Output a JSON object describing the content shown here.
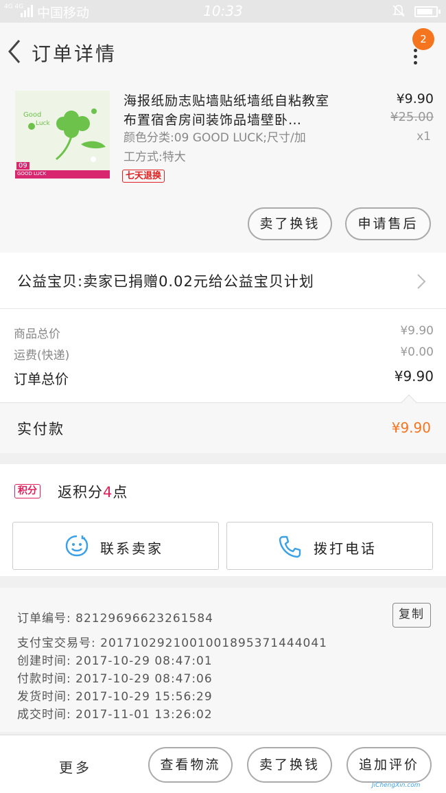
{
  "status_bar": {
    "signal_label": "4G 4G",
    "carrier": "中国移动",
    "time": "10:33",
    "icons": [
      "signal-icon",
      "bell-muted-icon",
      "battery-icon"
    ]
  },
  "nav": {
    "title": "订单详情",
    "badge_count": "2",
    "icons": [
      "back-arrow-icon",
      "more-dots-icon"
    ]
  },
  "item": {
    "title": "海报纸励志贴墙贴纸墙纸自粘教室布置宿舍房间装饰品墙壁卧…",
    "sku_line1": "颜色分类:09 GOOD LUCK;尺寸/加",
    "sku_line2": "工方式:特大",
    "tag": "七天退换",
    "price": "¥9.90",
    "original_price": "¥25.00",
    "quantity": "x1",
    "thumb_number": "09",
    "thumb_caption": "GOOD LUCK",
    "buttons": [
      "卖了换钱",
      "申请售后"
    ]
  },
  "charity": {
    "text": "公益宝贝:卖家已捐赠0.02元给公益宝贝计划"
  },
  "fees": {
    "rows": [
      {
        "label": "商品总价",
        "value": "¥9.90"
      },
      {
        "label": "运费(快递)",
        "value": "¥0.00"
      },
      {
        "label": "订单总价",
        "value": "¥9.90"
      }
    ]
  },
  "payment": {
    "label": "实付款",
    "value": "¥9.90"
  },
  "points": {
    "tag": "积分",
    "prefix": "返积分",
    "number": "4",
    "suffix": "点"
  },
  "contact": {
    "seller_label": "联系卖家",
    "phone_label": "拨打电话"
  },
  "order_info": {
    "copy_label": "复制",
    "lines": [
      "订单编号: 82129696623261584",
      "支付宝交易号: 2017102921001001895371444041",
      "创建时间: 2017-10-29 08:47:01",
      "付款时间: 2017-10-29 08:47:06",
      "发货时间: 2017-10-29 15:56:29",
      "成交时间: 2017-11-01 13:26:02"
    ]
  },
  "bottom_bar": {
    "more": "更多",
    "buttons": [
      "查看物流",
      "卖了换钱",
      "追加评价"
    ]
  },
  "watermark": "JiChengXin.com",
  "colors": {
    "accent_orange": "#f5751f",
    "tag_red": "#e02020",
    "points_pink": "#e0205a",
    "icon_blue": "#3aa0e8"
  }
}
